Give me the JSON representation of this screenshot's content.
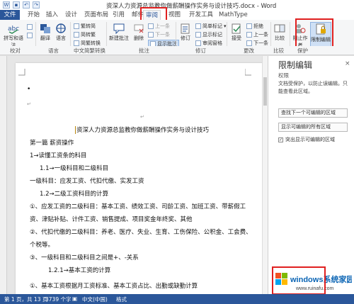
{
  "window": {
    "title": "资深人力资源总监教你做薪酬操作实务与设计技巧.docx - Word"
  },
  "tabs": {
    "file": "文件",
    "items": [
      "开始",
      "插入",
      "设计",
      "页面布局",
      "引用",
      "邮件",
      "审阅",
      "视图",
      "开发工具",
      "MathType"
    ],
    "active": "审阅"
  },
  "ribbon": {
    "proofing": {
      "spelling": "拼写和语法",
      "label": "校对"
    },
    "language": {
      "translate": "翻译",
      "language": "语言",
      "label": "语言"
    },
    "chinese": {
      "trad": "繁转简",
      "simp": "简转繁",
      "convert": "简繁转换",
      "label": "中文简繁转换"
    },
    "comments": {
      "new": "新建批注",
      "delete": "删除",
      "prev": "上一条",
      "next": "下一条",
      "show": "显示批注",
      "label": "批注"
    },
    "tracking": {
      "track": "修订",
      "markup": "简单标记",
      "show": "显示标记",
      "pane": "审阅窗格",
      "label": "修订"
    },
    "changes": {
      "accept": "接受",
      "reject": "拒绝",
      "prev": "上一条",
      "next": "下一条",
      "label": "更改"
    },
    "compare": {
      "compare": "比较",
      "label": "比较"
    },
    "protect": {
      "block": "阻止作者",
      "restrict": "限制编辑",
      "label": "保护"
    }
  },
  "document": {
    "title_line": "资深人力资源总监教你做薪酬操作实务与设计技巧",
    "lines": [
      "第一篇  薪资操作",
      "1→读懂工资条的科目",
      "1.1→一级科目和二级科目",
      "一级科目：应发工资、代扣代缴、实发工资",
      "1.2→二级工资科目的计算",
      "①、应发工资的二级科目：基本工资、绩效工资、司龄工资、加班工资、带薪假工",
      "资、津贴补贴、计件工资、销售提成、项目奖金年终奖、其他",
      "②、代扣代缴的二级科目：养老、医疗、失业、生育、工伤保险、公积金、工会费、",
      "个税等。",
      "③、一级科目和二级科目之间是+、-关系",
      "1.2.1→基本工资的计算",
      "①、基本工资根据月工资标准、基本工资占比、出勤或缺勤计算"
    ]
  },
  "pane": {
    "title": "限制编辑",
    "close": "×",
    "subtitle": "权限",
    "desc": "文档受保护，以防止误编辑。只能查看此区域。",
    "btn_next": "查找下一个可编辑的区域",
    "btn_all": "显示可编辑的所有区域",
    "chk_highlight": "突出显示可编辑的区域",
    "chk_checked": "✓"
  },
  "statusbar": {
    "page": "第 1 页，共 13 页",
    "words": "3739 个字",
    "lang": "中文(中国)",
    "mode": "格式"
  },
  "colors": {
    "accent": "#2b579a",
    "highlight": "#e02020"
  },
  "watermark": {
    "text": "windows系统家园",
    "url": "www.ruinafu.com"
  }
}
